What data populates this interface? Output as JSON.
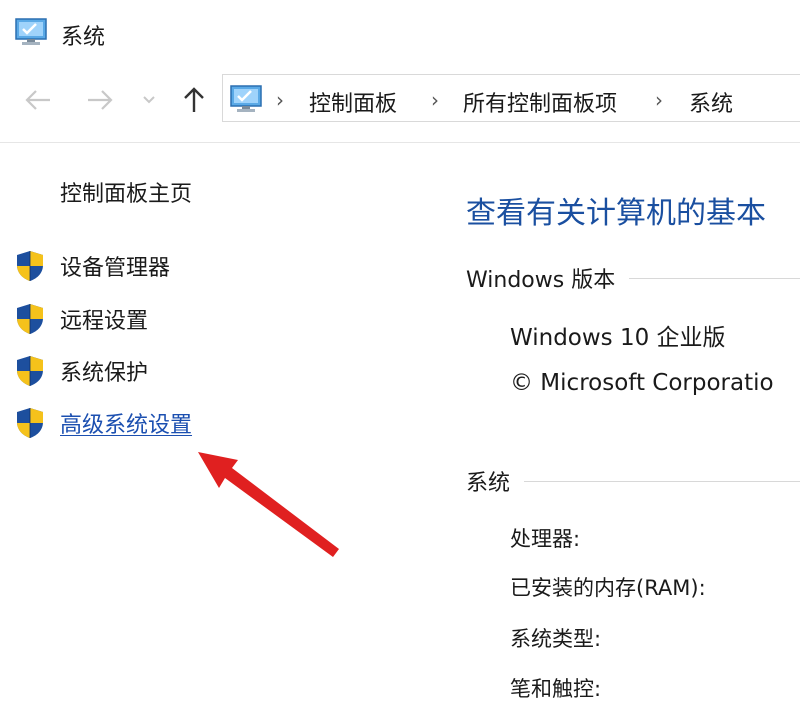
{
  "window": {
    "title": "系统",
    "icon": "system-monitor-icon"
  },
  "nav": {
    "back_icon": "arrow-left-icon",
    "forward_icon": "arrow-right-icon",
    "recent_icon": "chevron-down-icon",
    "up_icon": "arrow-up-icon"
  },
  "breadcrumb": {
    "icon": "control-panel-icon",
    "items": [
      "控制面板",
      "所有控制面板项",
      "系统"
    ],
    "separator": "›"
  },
  "sidebar": {
    "home": "控制面板主页",
    "items": [
      {
        "label": "设备管理器",
        "icon": "uac-shield-icon"
      },
      {
        "label": "远程设置",
        "icon": "uac-shield-icon"
      },
      {
        "label": "系统保护",
        "icon": "uac-shield-icon"
      },
      {
        "label": "高级系统设置",
        "icon": "uac-shield-icon",
        "highlighted": true
      }
    ]
  },
  "main": {
    "title": "查看有关计算机的基本",
    "edition_section": {
      "heading": "Windows 版本",
      "edition": "Windows 10 企业版",
      "copyright": "© Microsoft Corporatio"
    },
    "system_section": {
      "heading": "系统",
      "props": [
        "处理器:",
        "已安装的内存(RAM):",
        "系统类型:",
        "笔和触控:"
      ]
    }
  },
  "annotation": {
    "type": "red-arrow",
    "color": "#e02020",
    "points_to": "高级系统设置"
  },
  "colors": {
    "link": "#1b4fb0",
    "title": "#1a4fa0",
    "arrow": "#e02020"
  }
}
